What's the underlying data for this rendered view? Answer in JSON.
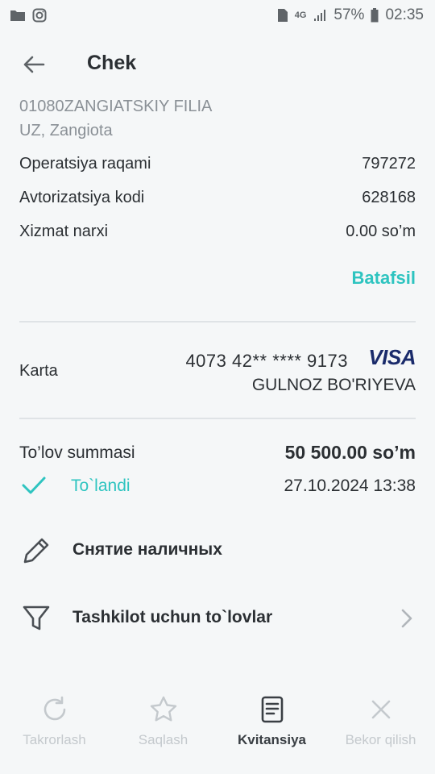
{
  "status_bar": {
    "battery": "57%",
    "time": "02:35",
    "network": "4G"
  },
  "header": {
    "title": "Chek"
  },
  "merchant": {
    "name": "01080ZANGIATSKIY FILIA",
    "location": "UZ, Zangiota"
  },
  "info_rows": [
    {
      "label": "Operatsiya raqami",
      "value": "797272"
    },
    {
      "label": "Avtorizatsiya kodi",
      "value": "628168"
    },
    {
      "label": "Xizmat narxi",
      "value": "0.00 so’m"
    }
  ],
  "details_link": "Batafsil",
  "card": {
    "label": "Karta",
    "number": "4073 42** **** 9173",
    "brand": "VISA",
    "holder": "GULNOZ BO'RIYEVA"
  },
  "payment": {
    "label": "To’lov summasi",
    "amount": "50 500.00 so’m",
    "status": "To`landi",
    "datetime": "27.10.2024 13:38"
  },
  "actions": [
    {
      "label": "Снятие наличных",
      "icon": "pencil-icon"
    },
    {
      "label": "Tashkilot uchun to`lovlar",
      "icon": "filter-icon"
    }
  ],
  "bottom_tabs": [
    {
      "label": "Takrorlash",
      "icon": "refresh-icon",
      "active": false
    },
    {
      "label": "Saqlash",
      "icon": "star-icon",
      "active": false
    },
    {
      "label": "Kvitansiya",
      "icon": "receipt-icon",
      "active": true
    },
    {
      "label": "Bekor qilish",
      "icon": "close-icon",
      "active": false
    }
  ],
  "colors": {
    "accent": "#2ec4c0",
    "text": "#2b2f33",
    "muted": "#8a9096",
    "visa": "#1a2b6b",
    "disabled": "#c4c9cd"
  }
}
